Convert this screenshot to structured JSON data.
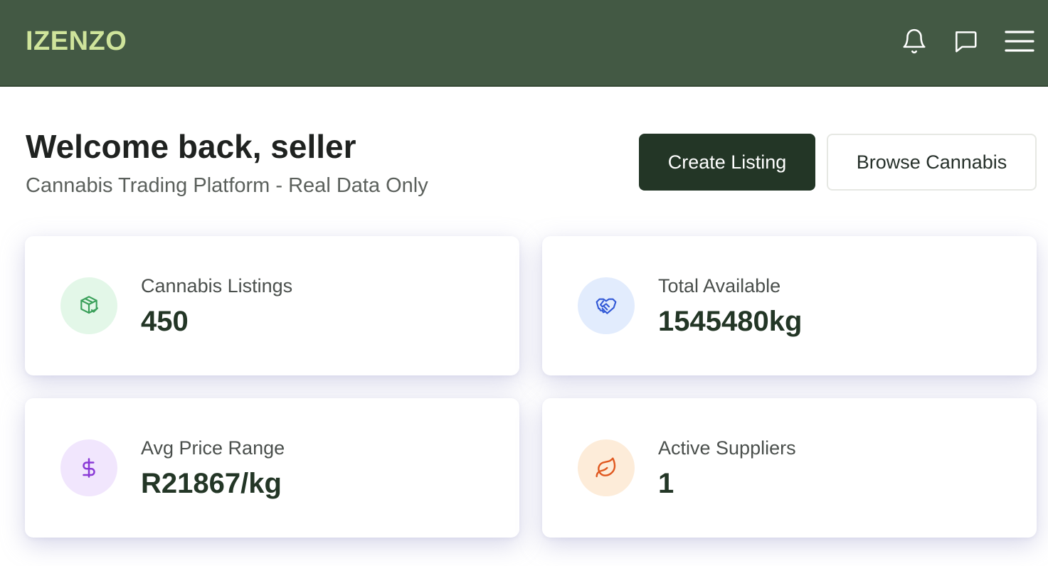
{
  "header": {
    "brand": "IZENZO",
    "icons": [
      "bell-icon",
      "chat-icon",
      "hamburger-menu-icon"
    ]
  },
  "welcome": {
    "title": "Welcome back, seller",
    "subtitle": "Cannabis Trading Platform - Real Data Only"
  },
  "actions": {
    "create_label": "Create Listing",
    "browse_label": "Browse Cannabis"
  },
  "stats": [
    {
      "label": "Cannabis Listings",
      "value": "450",
      "icon": "package-check-icon",
      "badge_color": "#e3f7e8",
      "icon_color": "#3aa05a"
    },
    {
      "label": "Total Available",
      "value": "1545480kg",
      "icon": "handshake-icon",
      "badge_color": "#e2ecfd",
      "icon_color": "#3158d6"
    },
    {
      "label": "Avg Price Range",
      "value": "R21867/kg",
      "icon": "dollar-icon",
      "badge_color": "#f1e6fd",
      "icon_color": "#8a3ad6"
    },
    {
      "label": "Active Suppliers",
      "value": "1",
      "icon": "leaf-icon",
      "badge_color": "#fdecd9",
      "icon_color": "#e0581f"
    }
  ],
  "colors": {
    "header_bg": "#435944",
    "brand": "#cfe49b",
    "primary_button": "#233626"
  }
}
